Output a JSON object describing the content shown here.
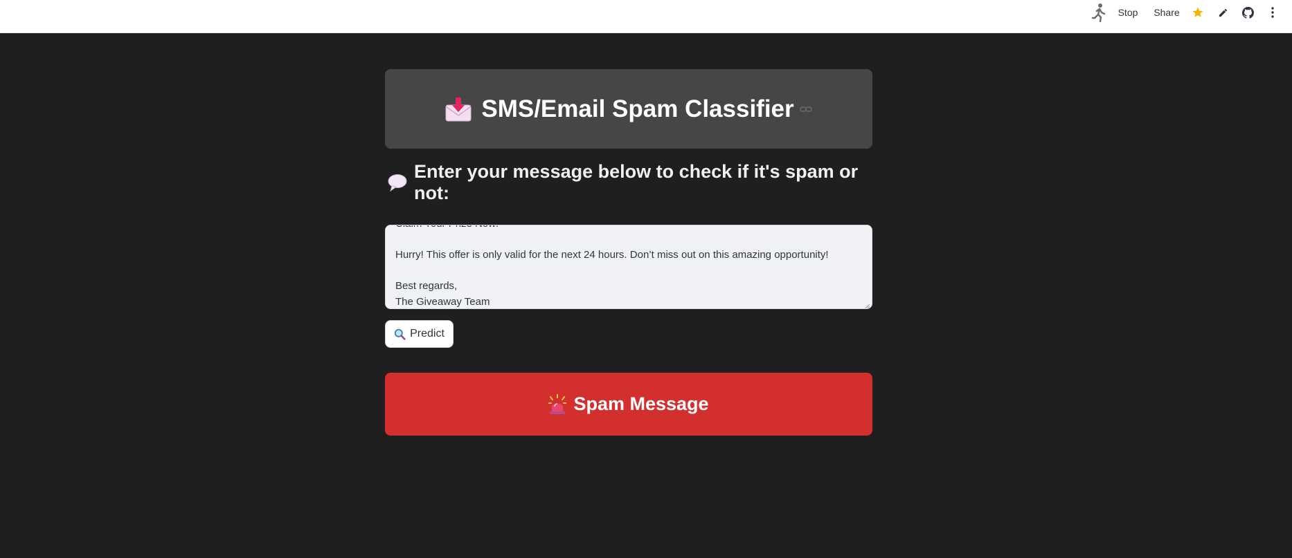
{
  "toolbar": {
    "stop_label": "Stop",
    "share_label": "Share",
    "icons": [
      "running-man-icon",
      "star-icon",
      "pencil-icon",
      "github-icon",
      "kebab-menu-icon"
    ],
    "star_color": "#f4b400"
  },
  "header": {
    "title": "SMS/Email Spam Classifier",
    "emoji": "envelope-with-arrow-icon",
    "background": "#464646"
  },
  "prompt": {
    "text": "Enter your message below to check if it's spam or not:",
    "emoji": "speech-balloon-icon"
  },
  "message_input": {
    "lines": [
      "Claim Your Prize Now!",
      "",
      "Hurry! This offer is only valid for the next 24 hours. Don’t miss out on this amazing opportunity!",
      "",
      "Best regards,",
      "The Giveaway Team"
    ],
    "background": "#f0f2f6"
  },
  "predict_button": {
    "label": "Predict",
    "emoji": "magnifying-glass-icon"
  },
  "result": {
    "label": "Spam Message",
    "emoji": "rotating-light-icon",
    "background": "#d32f2f"
  },
  "page_background": "#1f1f1f"
}
